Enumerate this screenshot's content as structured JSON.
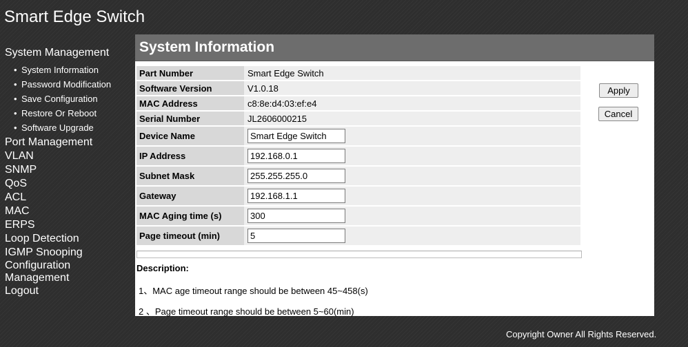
{
  "app": {
    "title": "Smart Edge Switch"
  },
  "sidebar": {
    "system_management": {
      "label": "System Management",
      "items": [
        {
          "label": "System Information"
        },
        {
          "label": "Password Modification"
        },
        {
          "label": "Save Configuration"
        },
        {
          "label": "Restore Or Reboot"
        },
        {
          "label": "Software Upgrade"
        }
      ]
    },
    "items": [
      {
        "label": "Port Management"
      },
      {
        "label": "VLAN"
      },
      {
        "label": "SNMP"
      },
      {
        "label": "QoS"
      },
      {
        "label": "ACL"
      },
      {
        "label": "MAC"
      },
      {
        "label": "ERPS"
      },
      {
        "label": "Loop Detection"
      },
      {
        "label": "IGMP Snooping"
      },
      {
        "label": "Configuration Management"
      },
      {
        "label": "Logout"
      }
    ],
    "bullet": "•"
  },
  "panel": {
    "title": "System Information",
    "rows": [
      {
        "label": "Part Number",
        "value": "Smart Edge Switch"
      },
      {
        "label": "Software Version",
        "value": "V1.0.18"
      },
      {
        "label": "MAC Address",
        "value": "c8:8e:d4:03:ef:e4"
      },
      {
        "label": "Serial Number",
        "value": "JL2606000215"
      }
    ],
    "fields": [
      {
        "label": "Device Name",
        "value": "Smart Edge Switch"
      },
      {
        "label": "IP Address",
        "value": "192.168.0.1"
      },
      {
        "label": "Subnet Mask",
        "value": "255.255.255.0"
      },
      {
        "label": "Gateway",
        "value": "192.168.1.1"
      },
      {
        "label": "MAC Aging time (s)",
        "value": "300"
      },
      {
        "label": "Page timeout (min)",
        "value": "5"
      }
    ],
    "buttons": {
      "apply": "Apply",
      "cancel": "Cancel"
    },
    "description": {
      "title": "Description:",
      "lines": [
        "1、MAC age timeout range should be between 45~458(s)",
        "2 、Page timeout range should be between 5~60(min)"
      ]
    }
  },
  "footer": {
    "copyright": "Copyright Owner All Rights Reserved."
  },
  "colors": {
    "header_bar": "#6d6d6d",
    "label_cell": "#d8d8d8",
    "value_cell": "#eeeeee",
    "page_bg": "#2e2e2e"
  }
}
